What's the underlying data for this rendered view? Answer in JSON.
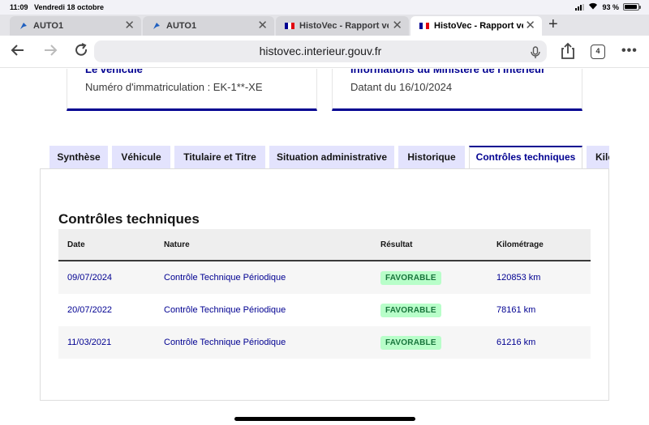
{
  "status_bar": {
    "time": "11:09",
    "date": "Vendredi 18 octobre",
    "battery": "93 %"
  },
  "browser_tabs": [
    {
      "title": "AUTO1",
      "icon": "auto1-favicon",
      "active": false
    },
    {
      "title": "AUTO1",
      "icon": "auto1-favicon",
      "active": false
    },
    {
      "title": "HistoVec - Rapport vendeur",
      "icon": "french-flag-favicon",
      "active": false
    },
    {
      "title": "HistoVec - Rapport vendeur",
      "icon": "french-flag-favicon",
      "active": true
    }
  ],
  "toolbar": {
    "url": "histovec.interieur.gouv.fr",
    "tab_count": "4"
  },
  "cards": {
    "vehicle": {
      "title": "Le véhicule",
      "text": "Numéro d'immatriculation : EK-1**-XE"
    },
    "ministry": {
      "title": "Informations du Ministère de l'Intérieur",
      "text": "Datant du 16/10/2024"
    }
  },
  "page_tabs": [
    {
      "label": "Synthèse"
    },
    {
      "label": "Véhicule"
    },
    {
      "label": "Titulaire et Titre"
    },
    {
      "label": "Situation administrative"
    },
    {
      "label": "Historique"
    },
    {
      "label": "Contrôles techniques"
    },
    {
      "label": "Kilo"
    }
  ],
  "section": {
    "title": "Contrôles techniques",
    "columns": [
      "Date",
      "Nature",
      "Résultat",
      "Kilométrage"
    ],
    "rows": [
      {
        "date": "09/07/2024",
        "nature": "Contrôle Technique Périodique",
        "result": "FAVORABLE",
        "km": "120853 km"
      },
      {
        "date": "20/07/2022",
        "nature": "Contrôle Technique Périodique",
        "result": "FAVORABLE",
        "km": "78161 km"
      },
      {
        "date": "11/03/2021",
        "nature": "Contrôle Technique Périodique",
        "result": "FAVORABLE",
        "km": "61216 km"
      }
    ]
  },
  "colors": {
    "primary_blue": "#000091",
    "tab_bg": "#e3e3fd",
    "badge_bg": "#b8fec9",
    "badge_text": "#18753c"
  }
}
